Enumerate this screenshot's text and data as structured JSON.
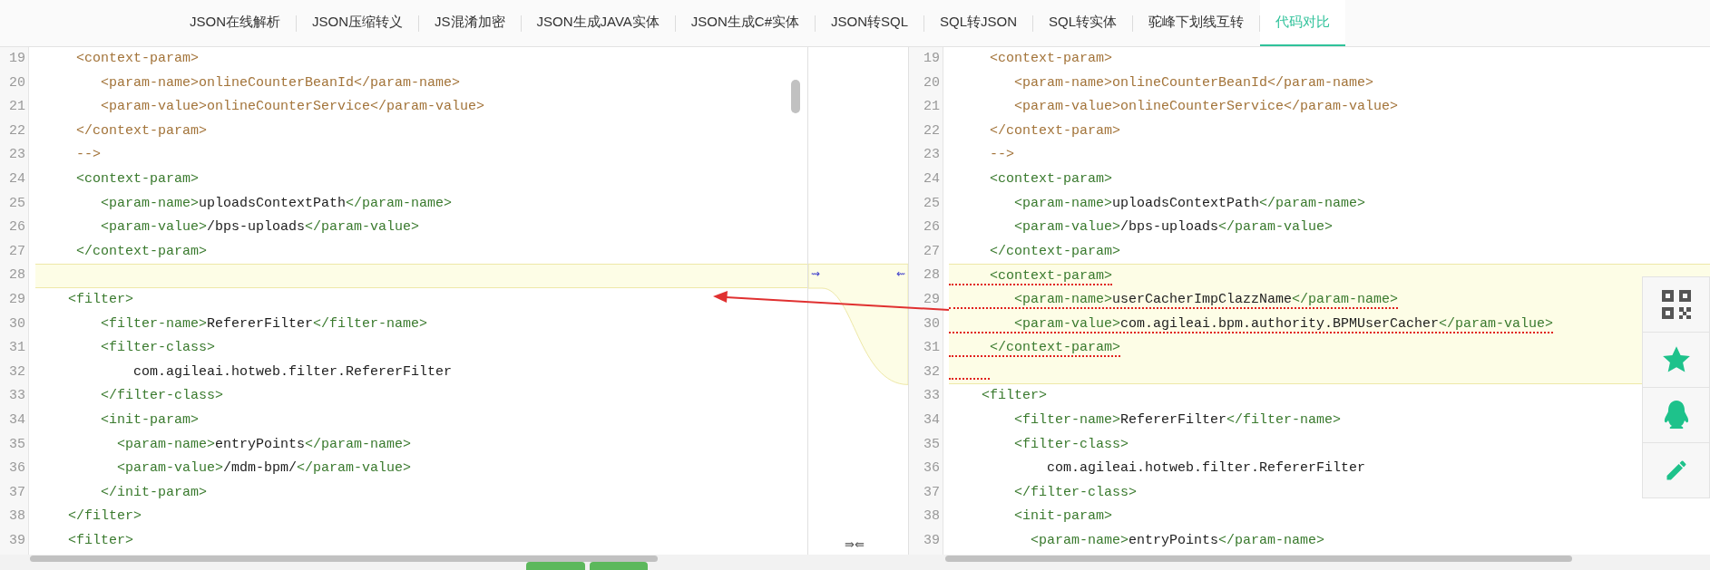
{
  "tabs": [
    {
      "label": "JSON在线解析",
      "selected": false
    },
    {
      "label": "JSON压缩转义",
      "selected": false
    },
    {
      "label": "JS混淆加密",
      "selected": false
    },
    {
      "label": "JSON生成JAVA实体",
      "selected": false
    },
    {
      "label": "JSON生成C#实体",
      "selected": false
    },
    {
      "label": "JSON转SQL",
      "selected": false
    },
    {
      "label": "SQL转JSON",
      "selected": false
    },
    {
      "label": "SQL转实体",
      "selected": false
    },
    {
      "label": "驼峰下划线互转",
      "selected": false
    },
    {
      "label": "代码对比",
      "selected": true
    }
  ],
  "left_pane": {
    "lines": [
      {
        "number": "19",
        "changed": false,
        "segments": [
          {
            "kind": "comment",
            "text": "     <context-param>"
          }
        ]
      },
      {
        "number": "20",
        "changed": false,
        "segments": [
          {
            "kind": "comment",
            "text": "        <param-name>onlineCounterBeanId</param-name>"
          }
        ]
      },
      {
        "number": "21",
        "changed": false,
        "segments": [
          {
            "kind": "comment",
            "text": "        <param-value>onlineCounterService</param-value>"
          }
        ]
      },
      {
        "number": "22",
        "changed": false,
        "segments": [
          {
            "kind": "comment",
            "text": "     </context-param>"
          }
        ]
      },
      {
        "number": "23",
        "changed": false,
        "segments": [
          {
            "kind": "comment",
            "text": "     -->"
          }
        ]
      },
      {
        "number": "24",
        "changed": false,
        "segments": [
          {
            "kind": "tag",
            "text": "     <context-param>"
          }
        ]
      },
      {
        "number": "25",
        "changed": false,
        "segments": [
          {
            "kind": "tag",
            "text": "        <param-name>"
          },
          {
            "kind": "text",
            "text": "uploadsContextPath"
          },
          {
            "kind": "tag",
            "text": "</param-name>"
          }
        ]
      },
      {
        "number": "26",
        "changed": false,
        "segments": [
          {
            "kind": "tag",
            "text": "        <param-value>"
          },
          {
            "kind": "text",
            "text": "/bps-uploads"
          },
          {
            "kind": "tag",
            "text": "</param-value>"
          }
        ]
      },
      {
        "number": "27",
        "changed": false,
        "segments": [
          {
            "kind": "tag",
            "text": "     </context-param>"
          }
        ]
      },
      {
        "number": "28",
        "changed": true
      },
      {
        "number": "29",
        "changed": false,
        "segments": [
          {
            "kind": "tag",
            "text": "    <filter>"
          }
        ]
      },
      {
        "number": "30",
        "changed": false,
        "segments": [
          {
            "kind": "tag",
            "text": "        <filter-name>"
          },
          {
            "kind": "text",
            "text": "RefererFilter"
          },
          {
            "kind": "tag",
            "text": "</filter-name>"
          }
        ]
      },
      {
        "number": "31",
        "changed": false,
        "segments": [
          {
            "kind": "tag",
            "text": "        <filter-class>"
          }
        ]
      },
      {
        "number": "32",
        "changed": false,
        "segments": [
          {
            "kind": "text",
            "text": "            com.agileai.hotweb.filter.RefererFilter"
          }
        ]
      },
      {
        "number": "33",
        "changed": false,
        "segments": [
          {
            "kind": "tag",
            "text": "        </filter-class>"
          }
        ]
      },
      {
        "number": "34",
        "changed": false,
        "segments": [
          {
            "kind": "tag",
            "text": "        <init-param>"
          }
        ]
      },
      {
        "number": "35",
        "changed": false,
        "segments": [
          {
            "kind": "tag",
            "text": "          <param-name>"
          },
          {
            "kind": "text",
            "text": "entryPoints"
          },
          {
            "kind": "tag",
            "text": "</param-name>"
          }
        ]
      },
      {
        "number": "36",
        "changed": false,
        "segments": [
          {
            "kind": "tag",
            "text": "          <param-value>"
          },
          {
            "kind": "text",
            "text": "/mdm-bpm/"
          },
          {
            "kind": "tag",
            "text": "</param-value>"
          }
        ]
      },
      {
        "number": "37",
        "changed": false,
        "segments": [
          {
            "kind": "tag",
            "text": "        </init-param>"
          }
        ]
      },
      {
        "number": "38",
        "changed": false,
        "segments": [
          {
            "kind": "tag",
            "text": "    </filter>"
          }
        ]
      },
      {
        "number": "39",
        "changed": false,
        "segments": [
          {
            "kind": "tag",
            "text": "    <filter>"
          }
        ]
      }
    ]
  },
  "merge_gap": {
    "copy_right": "⇝",
    "copy_left": "⇜",
    "scroll_lock": "⇛⇚"
  },
  "right_pane": {
    "lines": [
      {
        "number": "19",
        "changed": false,
        "marked": false,
        "segments": [
          {
            "kind": "comment",
            "text": "     <context-param>"
          }
        ]
      },
      {
        "number": "20",
        "changed": false,
        "marked": false,
        "segments": [
          {
            "kind": "comment",
            "text": "        <param-name>onlineCounterBeanId</param-name>"
          }
        ]
      },
      {
        "number": "21",
        "changed": false,
        "marked": false,
        "segments": [
          {
            "kind": "comment",
            "text": "        <param-value>onlineCounterService</param-value>"
          }
        ]
      },
      {
        "number": "22",
        "changed": false,
        "marked": false,
        "segments": [
          {
            "kind": "comment",
            "text": "     </context-param>"
          }
        ]
      },
      {
        "number": "23",
        "changed": false,
        "marked": false,
        "segments": [
          {
            "kind": "comment",
            "text": "     -->"
          }
        ]
      },
      {
        "number": "24",
        "changed": false,
        "marked": false,
        "segments": [
          {
            "kind": "tag",
            "text": "     <context-param>"
          }
        ]
      },
      {
        "number": "25",
        "changed": false,
        "marked": false,
        "segments": [
          {
            "kind": "tag",
            "text": "        <param-name>"
          },
          {
            "kind": "text",
            "text": "uploadsContextPath"
          },
          {
            "kind": "tag",
            "text": "</param-name>"
          }
        ]
      },
      {
        "number": "26",
        "changed": false,
        "marked": false,
        "segments": [
          {
            "kind": "tag",
            "text": "        <param-value>"
          },
          {
            "kind": "text",
            "text": "/bps-uploads"
          },
          {
            "kind": "tag",
            "text": "</param-value>"
          }
        ]
      },
      {
        "number": "27",
        "changed": false,
        "marked": false,
        "segments": [
          {
            "kind": "tag",
            "text": "     </context-param>"
          }
        ]
      },
      {
        "number": "28",
        "changed": true,
        "marked": true,
        "segments": [
          {
            "kind": "tag",
            "text": "     <context-param>"
          }
        ]
      },
      {
        "number": "29",
        "changed": true,
        "marked": true,
        "segments": [
          {
            "kind": "tag",
            "text": "        <param-name>"
          },
          {
            "kind": "text",
            "text": "userCacherImpClazzName"
          },
          {
            "kind": "tag",
            "text": "</param-name>"
          }
        ]
      },
      {
        "number": "30",
        "changed": true,
        "marked": true,
        "segments": [
          {
            "kind": "tag",
            "text": "        <param-value>"
          },
          {
            "kind": "text",
            "text": "com.agileai.bpm.authority.BPMUserCacher"
          },
          {
            "kind": "tag",
            "text": "</param-value>"
          }
        ]
      },
      {
        "number": "31",
        "changed": true,
        "marked": true,
        "segments": [
          {
            "kind": "tag",
            "text": "     </context-param>"
          }
        ]
      },
      {
        "number": "32",
        "changed": true,
        "marked": true
      },
      {
        "number": "33",
        "changed": false,
        "marked": false,
        "segments": [
          {
            "kind": "tag",
            "text": "    <filter>"
          }
        ]
      },
      {
        "number": "34",
        "changed": false,
        "marked": false,
        "segments": [
          {
            "kind": "tag",
            "text": "        <filter-name>"
          },
          {
            "kind": "text",
            "text": "RefererFilter"
          },
          {
            "kind": "tag",
            "text": "</filter-name>"
          }
        ]
      },
      {
        "number": "35",
        "changed": false,
        "marked": false,
        "segments": [
          {
            "kind": "tag",
            "text": "        <filter-class>"
          }
        ]
      },
      {
        "number": "36",
        "changed": false,
        "marked": false,
        "segments": [
          {
            "kind": "text",
            "text": "            com.agileai.hotweb.filter.RefererFilter"
          }
        ]
      },
      {
        "number": "37",
        "changed": false,
        "marked": false,
        "segments": [
          {
            "kind": "tag",
            "text": "        </filter-class>"
          }
        ]
      },
      {
        "number": "38",
        "changed": false,
        "marked": false,
        "segments": [
          {
            "kind": "tag",
            "text": "        <init-param>"
          }
        ]
      },
      {
        "number": "39",
        "changed": false,
        "marked": false,
        "segments": [
          {
            "kind": "tag",
            "text": "          <param-name>"
          },
          {
            "kind": "text",
            "text": "entryPoints"
          },
          {
            "kind": "tag",
            "text": "</param-name>"
          }
        ]
      }
    ]
  },
  "annotation_arrow": true,
  "side_toolbar": [
    {
      "kind": "qr"
    },
    {
      "kind": "star"
    },
    {
      "kind": "penguin"
    },
    {
      "kind": "pencil"
    }
  ]
}
